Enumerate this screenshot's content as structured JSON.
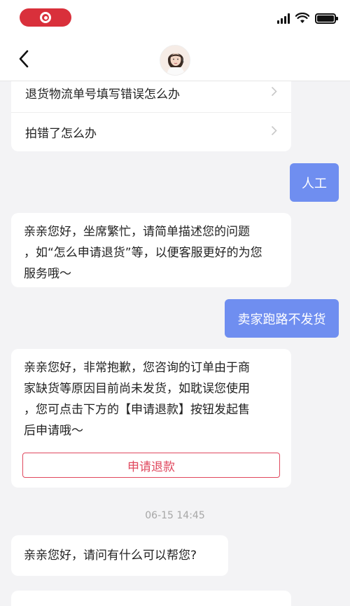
{
  "status_bar": {
    "watermark": "",
    "icons": [
      "screen-record-icon",
      "signal-icon",
      "wifi-icon",
      "battery-icon"
    ]
  },
  "nav": {
    "back_icon": "chevron-left-icon",
    "avatar": "agent-avatar"
  },
  "faq": {
    "items": [
      {
        "label": "退货物流单号填写错误怎么办",
        "icon": "chevron-right-icon"
      },
      {
        "label": "拍错了怎么办",
        "icon": "chevron-right-icon"
      }
    ]
  },
  "messages": {
    "user_1": "人工",
    "agent_1": {
      "lines": [
        "亲亲您好，坐席繁忙，请简单描述您的问题",
        "，如“怎么申请退货”等，以便客服更好的为您",
        "服务哦～"
      ]
    },
    "user_2": "卖家跑路不发货",
    "agent_2": {
      "lines": [
        "亲亲您好，非常抱歉，您咨询的订单由于商",
        "家缺货等原因目前尚未发货，如耽误您使用",
        "，您可点击下方的【申请退款】按钮发起售",
        "后申请哦～"
      ],
      "button_label": "申请退款"
    },
    "timestamp": "06-15 14:45",
    "agent_3": "亲亲您好，请问有什么可以帮您?"
  },
  "colors": {
    "user_bubble": "#6f8ef0",
    "accent_red": "#e0485e",
    "record_pill": "#d9303b"
  }
}
